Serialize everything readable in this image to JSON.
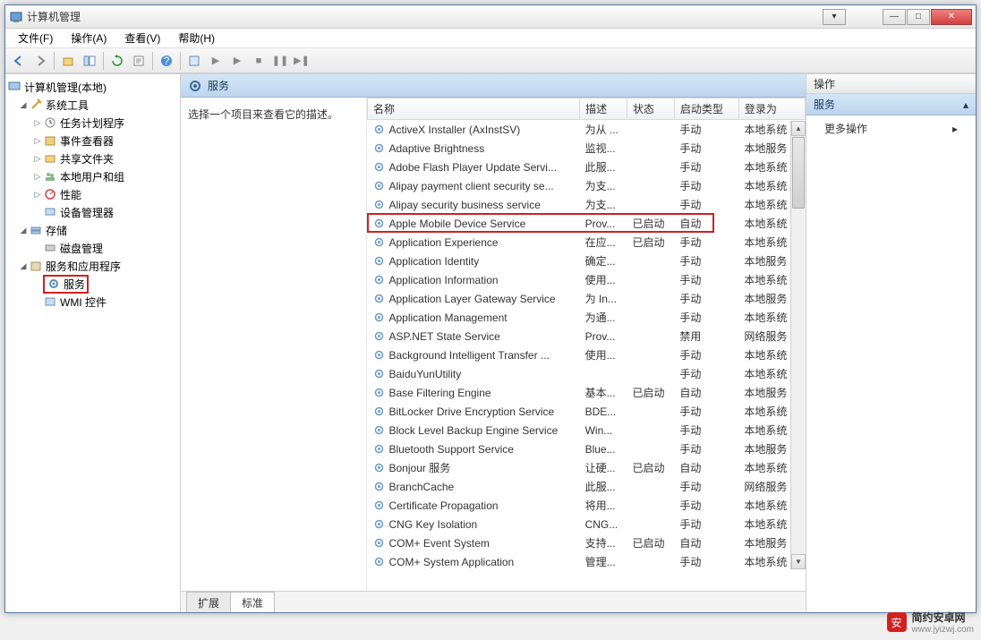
{
  "window": {
    "title": "计算机管理"
  },
  "menu": {
    "file": "文件(F)",
    "action": "操作(A)",
    "view": "查看(V)",
    "help": "帮助(H)"
  },
  "tree": {
    "root": "计算机管理(本地)",
    "system_tools": "系统工具",
    "task_scheduler": "任务计划程序",
    "event_viewer": "事件查看器",
    "shared_folders": "共享文件夹",
    "local_users": "本地用户和组",
    "performance": "性能",
    "device_manager": "设备管理器",
    "storage": "存储",
    "disk_management": "磁盘管理",
    "services_apps": "服务和应用程序",
    "services": "服务",
    "wmi": "WMI 控件"
  },
  "svc_header": "服务",
  "svc_desc": "选择一个项目来查看它的描述。",
  "columns": {
    "name": "名称",
    "desc": "描述",
    "status": "状态",
    "startup": "启动类型",
    "logon": "登录为"
  },
  "services": [
    {
      "name": "ActiveX Installer (AxInstSV)",
      "desc": "为从 ...",
      "status": "",
      "startup": "手动",
      "logon": "本地系统"
    },
    {
      "name": "Adaptive Brightness",
      "desc": "监视...",
      "status": "",
      "startup": "手动",
      "logon": "本地服务"
    },
    {
      "name": "Adobe Flash Player Update Servi...",
      "desc": "此服...",
      "status": "",
      "startup": "手动",
      "logon": "本地系统"
    },
    {
      "name": "Alipay payment client security se...",
      "desc": "为支...",
      "status": "",
      "startup": "手动",
      "logon": "本地系统"
    },
    {
      "name": "Alipay security business service",
      "desc": "为支...",
      "status": "",
      "startup": "手动",
      "logon": "本地系统"
    },
    {
      "name": "Apple Mobile Device Service",
      "desc": "Prov...",
      "status": "已启动",
      "startup": "自动",
      "logon": "本地系统",
      "hl": true
    },
    {
      "name": "Application Experience",
      "desc": "在应...",
      "status": "已启动",
      "startup": "手动",
      "logon": "本地系统"
    },
    {
      "name": "Application Identity",
      "desc": "确定...",
      "status": "",
      "startup": "手动",
      "logon": "本地服务"
    },
    {
      "name": "Application Information",
      "desc": "使用...",
      "status": "",
      "startup": "手动",
      "logon": "本地系统"
    },
    {
      "name": "Application Layer Gateway Service",
      "desc": "为 In...",
      "status": "",
      "startup": "手动",
      "logon": "本地服务"
    },
    {
      "name": "Application Management",
      "desc": "为通...",
      "status": "",
      "startup": "手动",
      "logon": "本地系统"
    },
    {
      "name": "ASP.NET State Service",
      "desc": "Prov...",
      "status": "",
      "startup": "禁用",
      "logon": "网络服务"
    },
    {
      "name": "Background Intelligent Transfer ...",
      "desc": "使用...",
      "status": "",
      "startup": "手动",
      "logon": "本地系统"
    },
    {
      "name": "BaiduYunUtility",
      "desc": "",
      "status": "",
      "startup": "手动",
      "logon": "本地系统"
    },
    {
      "name": "Base Filtering Engine",
      "desc": "基本...",
      "status": "已启动",
      "startup": "自动",
      "logon": "本地服务"
    },
    {
      "name": "BitLocker Drive Encryption Service",
      "desc": "BDE...",
      "status": "",
      "startup": "手动",
      "logon": "本地系统"
    },
    {
      "name": "Block Level Backup Engine Service",
      "desc": "Win...",
      "status": "",
      "startup": "手动",
      "logon": "本地系统"
    },
    {
      "name": "Bluetooth Support Service",
      "desc": "Blue...",
      "status": "",
      "startup": "手动",
      "logon": "本地服务"
    },
    {
      "name": "Bonjour 服务",
      "desc": "让硬...",
      "status": "已启动",
      "startup": "自动",
      "logon": "本地系统"
    },
    {
      "name": "BranchCache",
      "desc": "此服...",
      "status": "",
      "startup": "手动",
      "logon": "网络服务"
    },
    {
      "name": "Certificate Propagation",
      "desc": "将用...",
      "status": "",
      "startup": "手动",
      "logon": "本地系统"
    },
    {
      "name": "CNG Key Isolation",
      "desc": "CNG...",
      "status": "",
      "startup": "手动",
      "logon": "本地系统"
    },
    {
      "name": "COM+ Event System",
      "desc": "支持...",
      "status": "已启动",
      "startup": "自动",
      "logon": "本地服务"
    },
    {
      "name": "COM+ System Application",
      "desc": "管理...",
      "status": "",
      "startup": "手动",
      "logon": "本地系统"
    }
  ],
  "tabs": {
    "extended": "扩展",
    "standard": "标准"
  },
  "actions": {
    "header": "操作",
    "section": "服务",
    "more": "更多操作"
  },
  "watermark": {
    "brand": "简约安卓网",
    "url": "www.jyizwj.com"
  }
}
